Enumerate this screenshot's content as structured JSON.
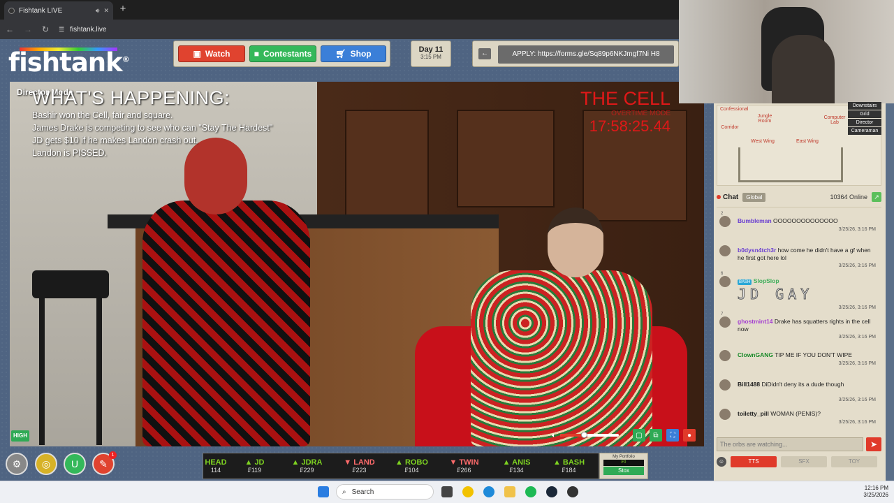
{
  "browser": {
    "tab_title": "Fishtank LIVE",
    "url": "fishtank.live"
  },
  "site": {
    "logo": "fishtank",
    "nav": {
      "watch": "Watch",
      "contestants": "Contestants",
      "shop": "Shop"
    },
    "day": {
      "label": "Day 11",
      "time": "3:15 PM"
    },
    "apply_text": "APPLY: https://forms.gle/Sq89p6NKJmgf7Ni H8"
  },
  "video": {
    "mode_label": "Director Mode",
    "happening_title": "WHAT'S HAPPENING:",
    "happening_lines": [
      "Bashir won the Cell, fair and square.",
      "James Drake is competing to see who can \"Stay The Hardest\"",
      "JD gets $10 if he makes Landon crash out.",
      "Landon is PISSED."
    ],
    "overlay": {
      "title": "THE CELL",
      "subtitle": "OVERTIME MODE",
      "timer": "17:58:25.44"
    },
    "quality_badge": "HIGH",
    "volume_level": 0.4
  },
  "ticker": [
    {
      "name": "HEAD",
      "value": "114",
      "trend": "up"
    },
    {
      "name": "JD",
      "value": "119",
      "trend": "up"
    },
    {
      "name": "JDRA",
      "value": "229",
      "trend": "up"
    },
    {
      "name": "LAND",
      "value": "223",
      "trend": "down"
    },
    {
      "name": "ROBO",
      "value": "104",
      "trend": "up"
    },
    {
      "name": "TWIN",
      "value": "266",
      "trend": "down"
    },
    {
      "name": "ANIS",
      "value": "134",
      "trend": "up"
    },
    {
      "name": "BASH",
      "value": "184",
      "trend": "up"
    }
  ],
  "portfolio": {
    "label": "My Portfolio",
    "value": "₣0",
    "button": "Stox"
  },
  "notification_count": "1",
  "map": {
    "rooms": [
      "Confessional",
      "Jungle Room",
      "Computer Lab",
      "Corridor",
      "West Wing",
      "East Wing"
    ],
    "buttons": [
      "Downstairs",
      "Grid",
      "Director",
      "Cameraman"
    ]
  },
  "chat": {
    "title": "Chat",
    "tab": "Global",
    "online": "10364 Online",
    "messages": [
      {
        "num": "2",
        "user": "Bumbleman",
        "text": "OOOOOOOOOOOOOO",
        "time": "3/25/26, 3:16 PM",
        "color": "#6a3fd1"
      },
      {
        "num": "",
        "user": "b0dysn4tch3r",
        "text": "how come he didn't have a gf when he first got here lol",
        "time": "3/25/26, 3:16 PM",
        "color": "#6a3fd1"
      },
      {
        "num": "6",
        "user": "SlopSlop",
        "badge": "BASH",
        "text": "JD GAY",
        "time": "3/25/26, 3:16 PM",
        "color": "#3fae5b"
      },
      {
        "num": "7",
        "user": "ghostmint14",
        "text": "Drake has squatters rights in the cell now",
        "time": "3/25/26, 3:16 PM",
        "color": "#a43fd1"
      },
      {
        "num": "",
        "user": "ClownGANG",
        "text": "TIP ME IF YOU DON'T WIPE",
        "time": "3/25/26, 3:16 PM",
        "color": "#1a8a2a"
      },
      {
        "num": "",
        "user": "Bill1488",
        "text": "DiDidn't deny its a dude though",
        "time": "3/25/26, 3:16 PM",
        "color": "#222222"
      },
      {
        "num": "",
        "user": "toiletty_pill",
        "text": "WOMAN (PENIS)?",
        "time": "3/25/26, 3:16 PM",
        "color": "#222222"
      }
    ],
    "input_placeholder": "The orbs are watching...",
    "buttons": {
      "tts": "TTS",
      "sfx": "SFX",
      "toy": "TOY"
    }
  },
  "taskbar": {
    "search": "Search",
    "time": "12:16 PM",
    "date": "3/25/2026"
  },
  "colors": {
    "accent_red": "#e03a2a",
    "green": "#2faa55",
    "blue": "#3b7fd8",
    "panel": "#dcd6c4"
  }
}
